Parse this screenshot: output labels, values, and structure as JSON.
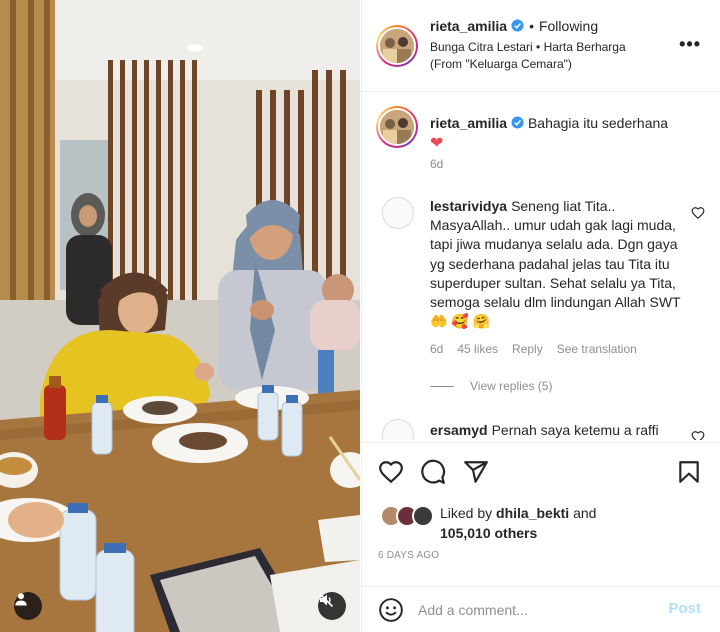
{
  "post": {
    "author": "rieta_amilia",
    "follow_status": "Following",
    "audio": "Bunga Citra Lestari • Harta Berharga (From \"Keluarga Cemara\")",
    "more_icon": "more-horizontal-icon"
  },
  "caption": {
    "username": "rieta_amilia",
    "text": "Bahagia itu sederhana",
    "emoji": "❤",
    "time": "6d"
  },
  "comments": [
    {
      "username": "lestarividya",
      "text": "Seneng liat Tita.. MasyaAllah.. umur udah gak lagi muda, tapi jiwa mudanya selalu ada. Dgn gaya yg sederhana padahal jelas tau Tita itu superduper sultan. Sehat selalu ya Tita, semoga selalu dlm lindungan Allah SWT 🤲 🥰 🤗",
      "time": "6d",
      "likes": "45 likes",
      "reply": "Reply",
      "translate": "See translation",
      "view_replies": "View replies (5)"
    },
    {
      "username": "ersamyd",
      "text": "Pernah saya ketemu a raffi"
    }
  ],
  "actions": {
    "like_icon": "heart-icon",
    "comment_icon": "comment-icon",
    "share_icon": "share-icon",
    "save_icon": "bookmark-icon"
  },
  "likes": {
    "prefix": "Liked by ",
    "user": "dhila_bekti",
    "and": " and",
    "others": "105,010 others"
  },
  "timestamp": "6 DAYS AGO",
  "composer": {
    "placeholder": "Add a comment...",
    "post_label": "Post",
    "emoji_icon": "smiley-icon"
  },
  "media": {
    "user_tag_icon": "user-tag-icon",
    "mute_icon": "muted-speaker-icon"
  },
  "colors": {
    "verified": "#3897f0",
    "post_disabled": "#b2dffc",
    "caption_heart": "#ed4956"
  }
}
